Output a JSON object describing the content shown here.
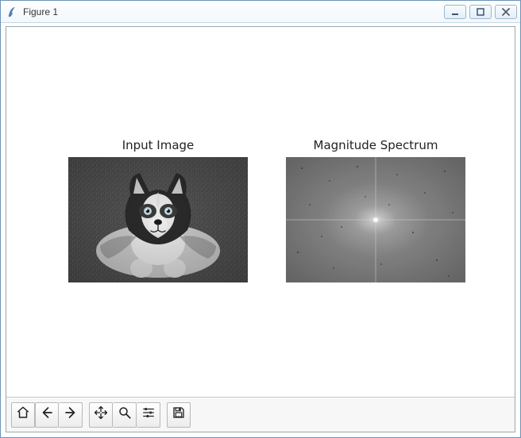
{
  "window": {
    "title": "Figure 1"
  },
  "plots": {
    "left_title": "Input Image",
    "right_title": "Magnitude Spectrum"
  },
  "toolbar": {
    "home": "Home",
    "back": "Back",
    "forward": "Forward",
    "pan": "Pan",
    "zoom": "Zoom",
    "configure": "Configure subplots",
    "save": "Save"
  },
  "window_controls": {
    "minimize": "Minimize",
    "maximize": "Maximize",
    "close": "Close"
  }
}
